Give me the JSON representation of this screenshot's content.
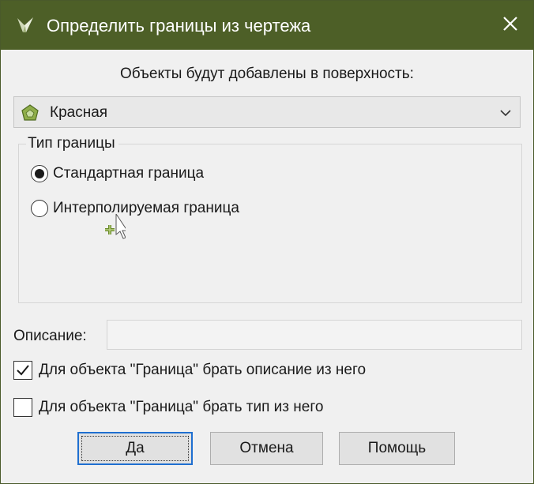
{
  "window": {
    "title": "Определить границы из чертежа",
    "titlebar_color": "#4d5f27",
    "app_icon": "civil3d-leaf-icon",
    "close_icon": "close-icon"
  },
  "prompt": {
    "text": "Объекты будут добавлены в поверхность:"
  },
  "surface_select": {
    "value": "Красная",
    "icon": "surface-icon",
    "arrow_icon": "chevron-down-icon"
  },
  "boundary_type": {
    "legend": "Тип границы",
    "options": [
      {
        "label": "Стандартная граница",
        "selected": true
      },
      {
        "label": "Интерполируемая граница",
        "selected": false
      }
    ]
  },
  "description": {
    "label": "Описание:",
    "value": ""
  },
  "checkboxes": [
    {
      "label": "Для объекта \"Граница\" брать описание из него",
      "checked": true
    },
    {
      "label": "Для объекта \"Граница\" брать тип из него",
      "checked": false
    }
  ],
  "buttons": {
    "ok": "Да",
    "cancel": "Отмена",
    "help": "Помощь"
  },
  "colors": {
    "accent_focus": "#1f6fd0",
    "surface_icon": "#7a9a3a"
  }
}
